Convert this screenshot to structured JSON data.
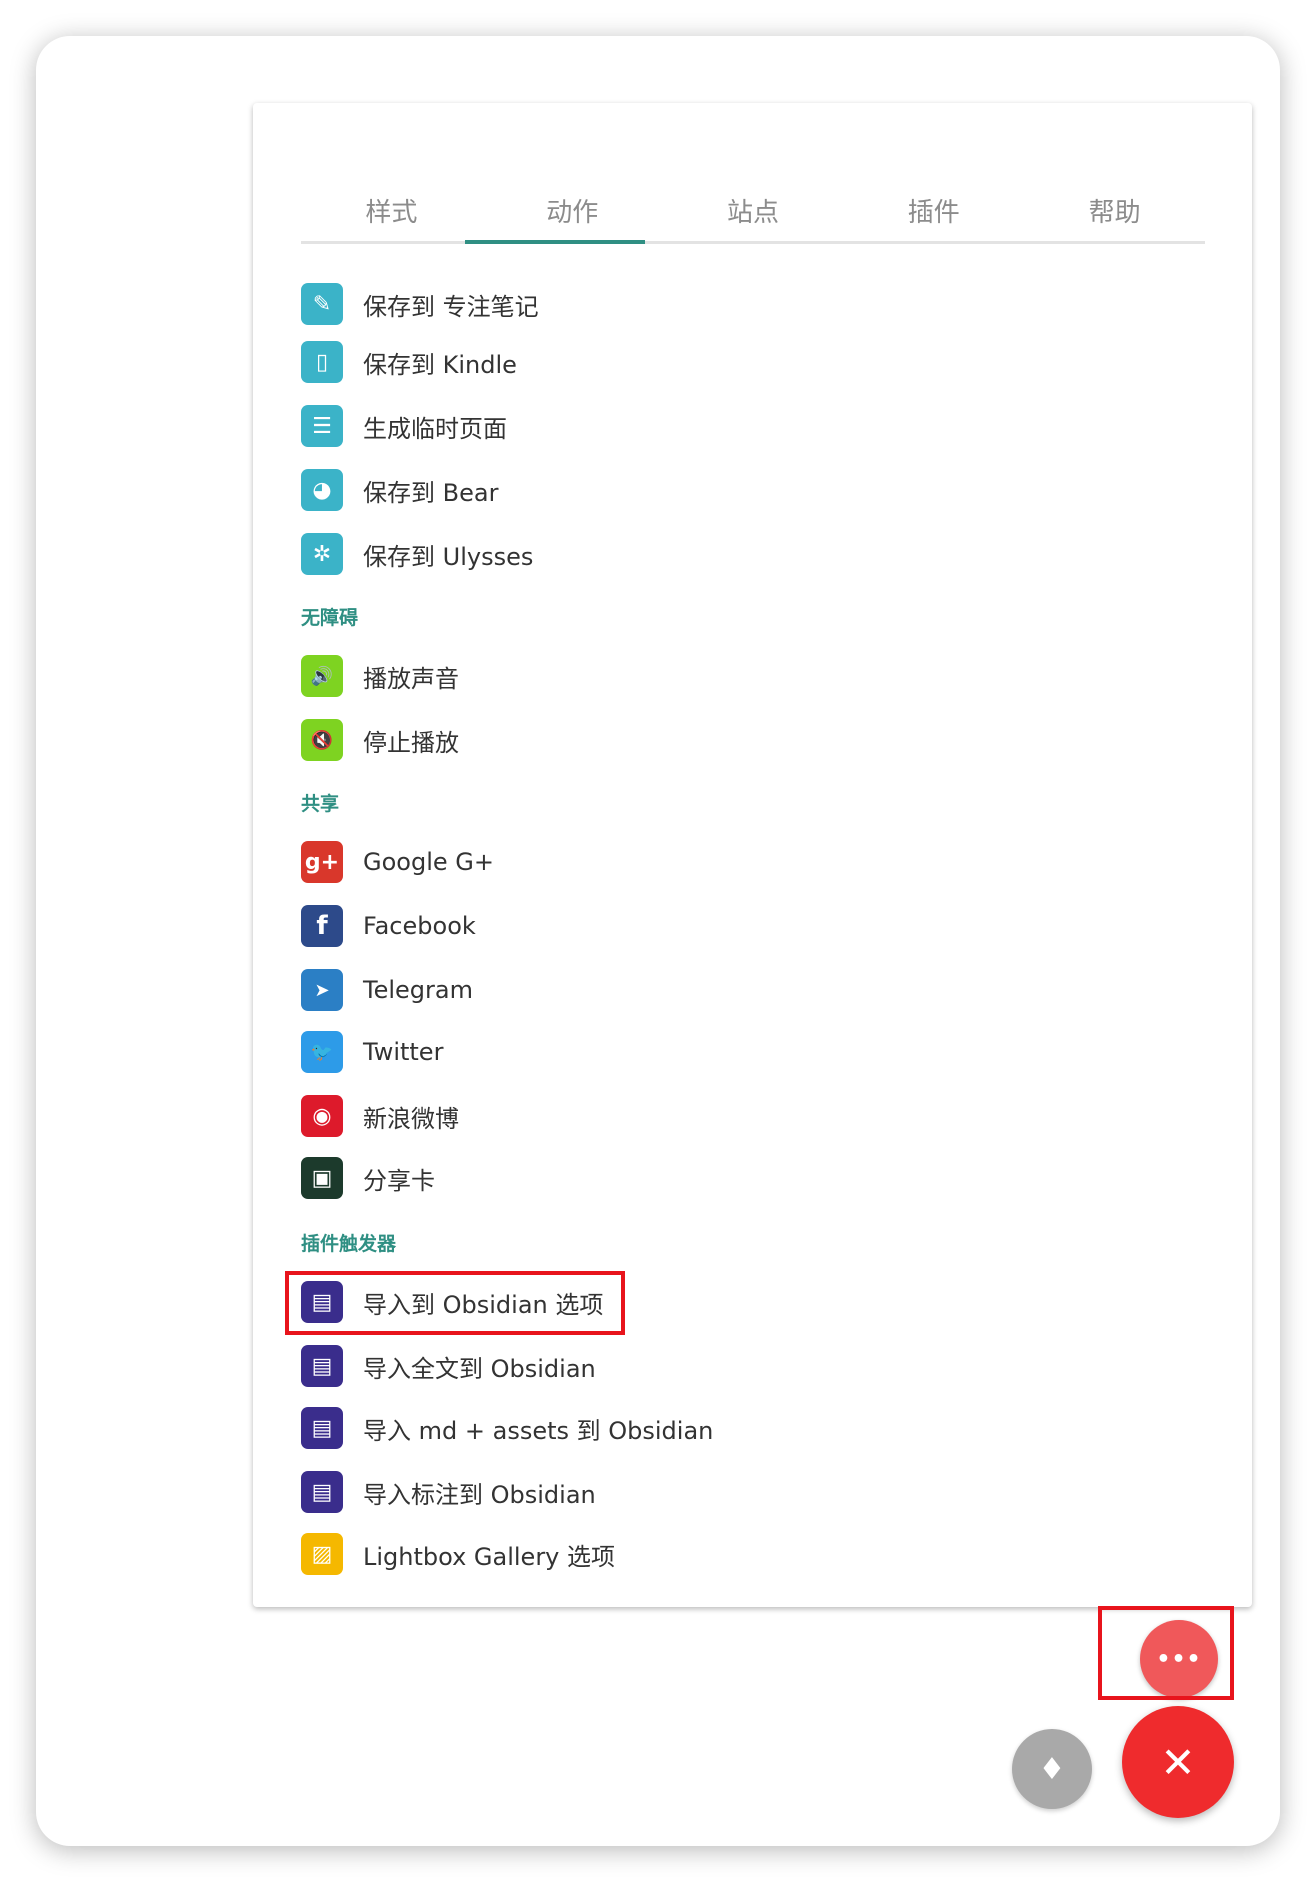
{
  "tabs": [
    "样式",
    "动作",
    "站点",
    "插件",
    "帮助"
  ],
  "active_tab": "动作",
  "items_top": [
    {
      "label": "保存到 专注笔记",
      "color": "#3bb3c8",
      "glyph": "✎"
    },
    {
      "label": "保存到 Kindle",
      "color": "#3bb3c8",
      "glyph": "▯"
    },
    {
      "label": "生成临时页面",
      "color": "#3bb3c8",
      "glyph": "☰"
    },
    {
      "label": "保存到 Bear",
      "color": "#3bb3c8",
      "glyph": "◕"
    },
    {
      "label": "保存到 Ulysses",
      "color": "#3bb3c8",
      "glyph": "✲"
    }
  ],
  "sections": {
    "accessibility": "无障碍",
    "share": "共享",
    "plugin_triggers": "插件触发器"
  },
  "items_accessibility": [
    {
      "label": "播放声音",
      "color": "#7ed321",
      "glyph": "🔊"
    },
    {
      "label": "停止播放",
      "color": "#7ed321",
      "glyph": "🔇"
    }
  ],
  "items_share": [
    {
      "label": "Google G+",
      "color": "#d9372b",
      "glyph": "g+"
    },
    {
      "label": "Facebook",
      "color": "#2d4a8a",
      "glyph": "f"
    },
    {
      "label": "Telegram",
      "color": "#2b7fc5",
      "glyph": "➤"
    },
    {
      "label": "Twitter",
      "color": "#2d9be8",
      "glyph": "🐦"
    },
    {
      "label": "新浪微博",
      "color": "#dd1a2b",
      "glyph": "◉"
    },
    {
      "label": "分享卡",
      "color": "#1c3a2c",
      "glyph": "▣"
    }
  ],
  "items_plugins": [
    {
      "label": "导入到 Obsidian 选项",
      "color": "#3a2d8c",
      "glyph": "▤"
    },
    {
      "label": "导入全文到 Obsidian",
      "color": "#3a2d8c",
      "glyph": "▤"
    },
    {
      "label": "导入 md + assets 到 Obsidian",
      "color": "#3a2d8c",
      "glyph": "▤"
    },
    {
      "label": "导入标注到 Obsidian",
      "color": "#3a2d8c",
      "glyph": "▤"
    },
    {
      "label": "Lightbox Gallery 选项",
      "color": "#f5b800",
      "glyph": "▨"
    }
  ],
  "fabs": {
    "more": {
      "color": "#f0585a",
      "glyph": "•••"
    },
    "light": {
      "color": "#a9a9a9",
      "glyph": "♦"
    },
    "close": {
      "color": "#ef2b2d",
      "glyph": "✕"
    }
  },
  "colors": {
    "accent": "#2f8f83",
    "highlight_box": "#e8141c"
  }
}
